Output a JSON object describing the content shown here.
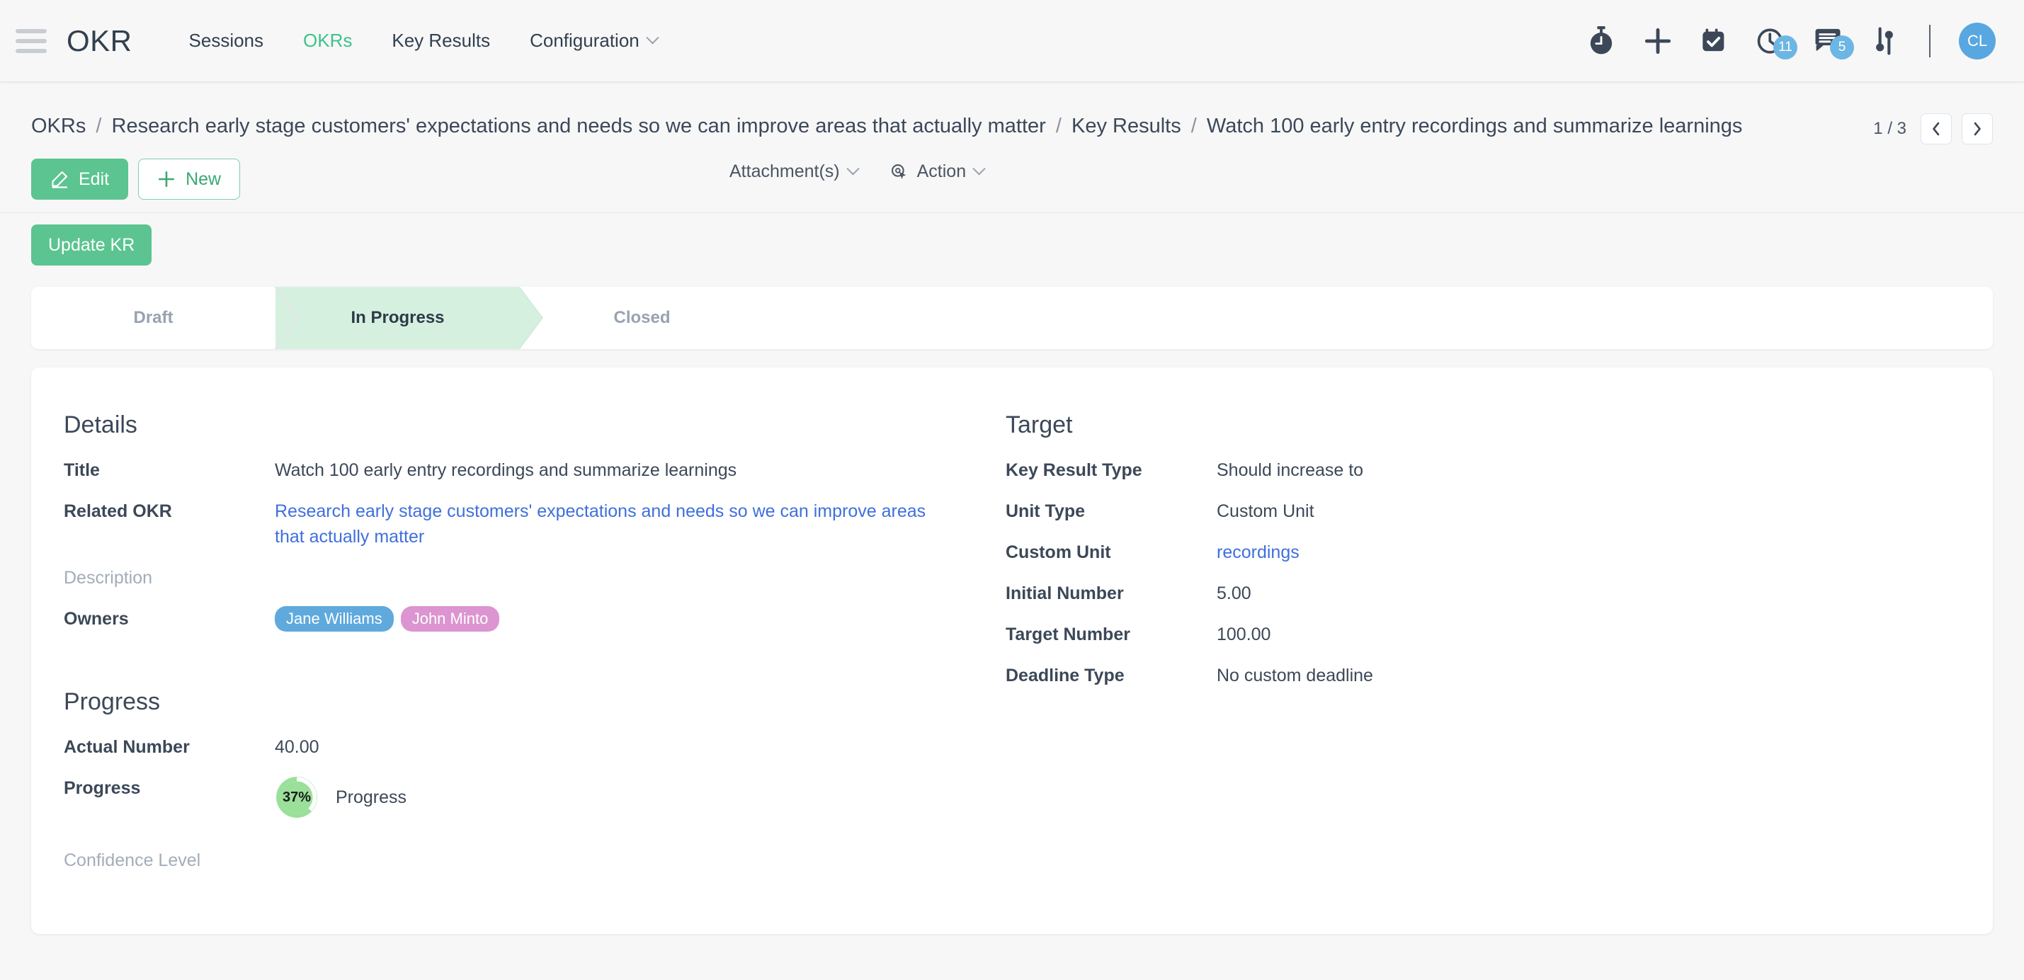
{
  "app": {
    "brand": "OKR",
    "menu_icon": "hamburger-icon"
  },
  "nav": {
    "items": [
      {
        "label": "Sessions",
        "active": false,
        "dropdown": false
      },
      {
        "label": "OKRs",
        "active": true,
        "dropdown": false
      },
      {
        "label": "Key Results",
        "active": false,
        "dropdown": false
      },
      {
        "label": "Configuration",
        "active": false,
        "dropdown": true
      }
    ],
    "right_icons": [
      {
        "name": "stopwatch-icon",
        "badge": ""
      },
      {
        "name": "plus-icon",
        "badge": ""
      },
      {
        "name": "calendar-check-icon",
        "badge": ""
      },
      {
        "name": "clock-activity-icon",
        "badge": "11"
      },
      {
        "name": "messages-icon",
        "badge": "5"
      },
      {
        "name": "settings-sliders-icon",
        "badge": ""
      }
    ],
    "avatar_initials": "CL"
  },
  "breadcrumb": {
    "parts": [
      "OKRs",
      "Research early stage customers' expectations and needs so we can improve areas that actually matter",
      "Key Results",
      "Watch 100 early entry recordings and summarize learnings"
    ],
    "separator": "/"
  },
  "pager": {
    "count": "1 / 3",
    "prev_icon": "chevron-left-icon",
    "next_icon": "chevron-right-icon"
  },
  "toolbar": {
    "edit_label": "Edit",
    "new_label": "New",
    "attachments_label": "Attachment(s)",
    "action_label": "Action",
    "update_kr_label": "Update KR"
  },
  "status": {
    "steps": [
      {
        "label": "Draft",
        "active": false
      },
      {
        "label": "In Progress",
        "active": true
      },
      {
        "label": "Closed",
        "active": false
      }
    ]
  },
  "details": {
    "title": "Details",
    "fields": [
      {
        "label": "Title",
        "value": "Watch 100 early entry recordings and summarize learnings",
        "muted": false,
        "link": false
      },
      {
        "label": "Related OKR",
        "value": "Research early stage customers' expectations and needs so we can improve areas that actually matter",
        "muted": false,
        "link": true
      },
      {
        "label": "Description",
        "value": "",
        "muted": true,
        "link": false
      }
    ],
    "owners_label": "Owners",
    "owners": [
      {
        "name": "Jane Williams",
        "color": "#5fa9dd"
      },
      {
        "name": "John Minto",
        "color": "#dc95d0"
      }
    ]
  },
  "target": {
    "title": "Target",
    "fields": [
      {
        "label": "Key Result Type",
        "value": "Should increase to",
        "link": false
      },
      {
        "label": "Unit Type",
        "value": "Custom Unit",
        "link": false
      },
      {
        "label": "Custom Unit",
        "value": "recordings",
        "link": true
      },
      {
        "label": "Initial Number",
        "value": "5.00",
        "link": false
      },
      {
        "label": "Target Number",
        "value": "100.00",
        "link": false
      },
      {
        "label": "Deadline Type",
        "value": "No custom deadline",
        "link": false
      }
    ]
  },
  "progress": {
    "title": "Progress",
    "actual_number_label": "Actual Number",
    "actual_number_value": "40.00",
    "progress_label": "Progress",
    "gauge_percent_text": "37%",
    "gauge_percent_value": 37,
    "gauge_caption": "Progress",
    "confidence_level_label": "Confidence Level"
  },
  "colors": {
    "accent_green": "#5bc490",
    "active_step_bg": "#d6f0e0",
    "link_blue": "#3f6fdd",
    "badge_blue": "#6cb6e3",
    "avatar_blue": "#58a7e0",
    "gauge_green": "#9ae09a",
    "page_bg": "#f7f7f8"
  }
}
